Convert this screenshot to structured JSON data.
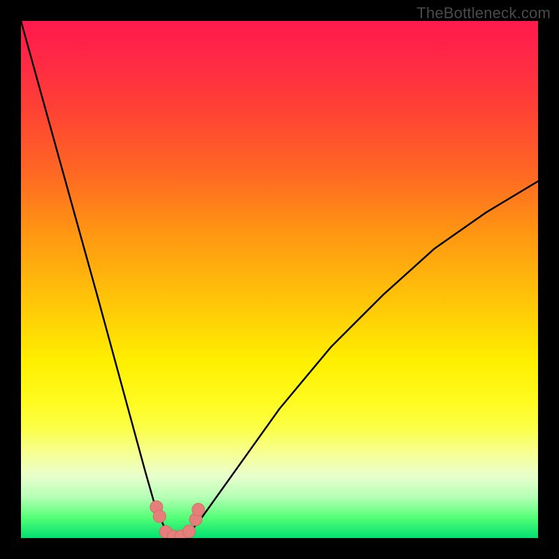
{
  "watermark": "TheBottleneck.com",
  "colors": {
    "frame": "#000000",
    "curve": "#000000",
    "marker_fill": "#e57f7b",
    "marker_stroke": "#d36b67"
  },
  "chart_data": {
    "type": "line",
    "title": "",
    "xlabel": "",
    "ylabel": "",
    "xlim": [
      0,
      100
    ],
    "ylim": [
      0,
      100
    ],
    "note": "Bottleneck-style V curve. Y is bottleneck percentage (lower = better / green). Background encodes Y via color gradient red→yellow→green. Numeric values are estimated from curve geometry; axes have no printed tick labels.",
    "series": [
      {
        "name": "bottleneck-curve",
        "x": [
          0,
          5,
          10,
          15,
          18,
          21,
          24,
          26,
          28,
          29.5,
          31,
          33,
          35,
          40,
          45,
          50,
          55,
          60,
          70,
          80,
          90,
          100
        ],
        "y": [
          100,
          82,
          64,
          46,
          35,
          24,
          13,
          6,
          1.5,
          0.3,
          0.3,
          1.5,
          4,
          11,
          18,
          25,
          31,
          37,
          47,
          56,
          63,
          69
        ]
      }
    ],
    "markers": {
      "name": "highlighted-points",
      "x": [
        26.2,
        26.8,
        28.0,
        29.5,
        31.0,
        32.5,
        33.8,
        34.3
      ],
      "y": [
        6.0,
        4.2,
        1.2,
        0.3,
        0.3,
        1.3,
        3.6,
        5.5
      ]
    }
  }
}
